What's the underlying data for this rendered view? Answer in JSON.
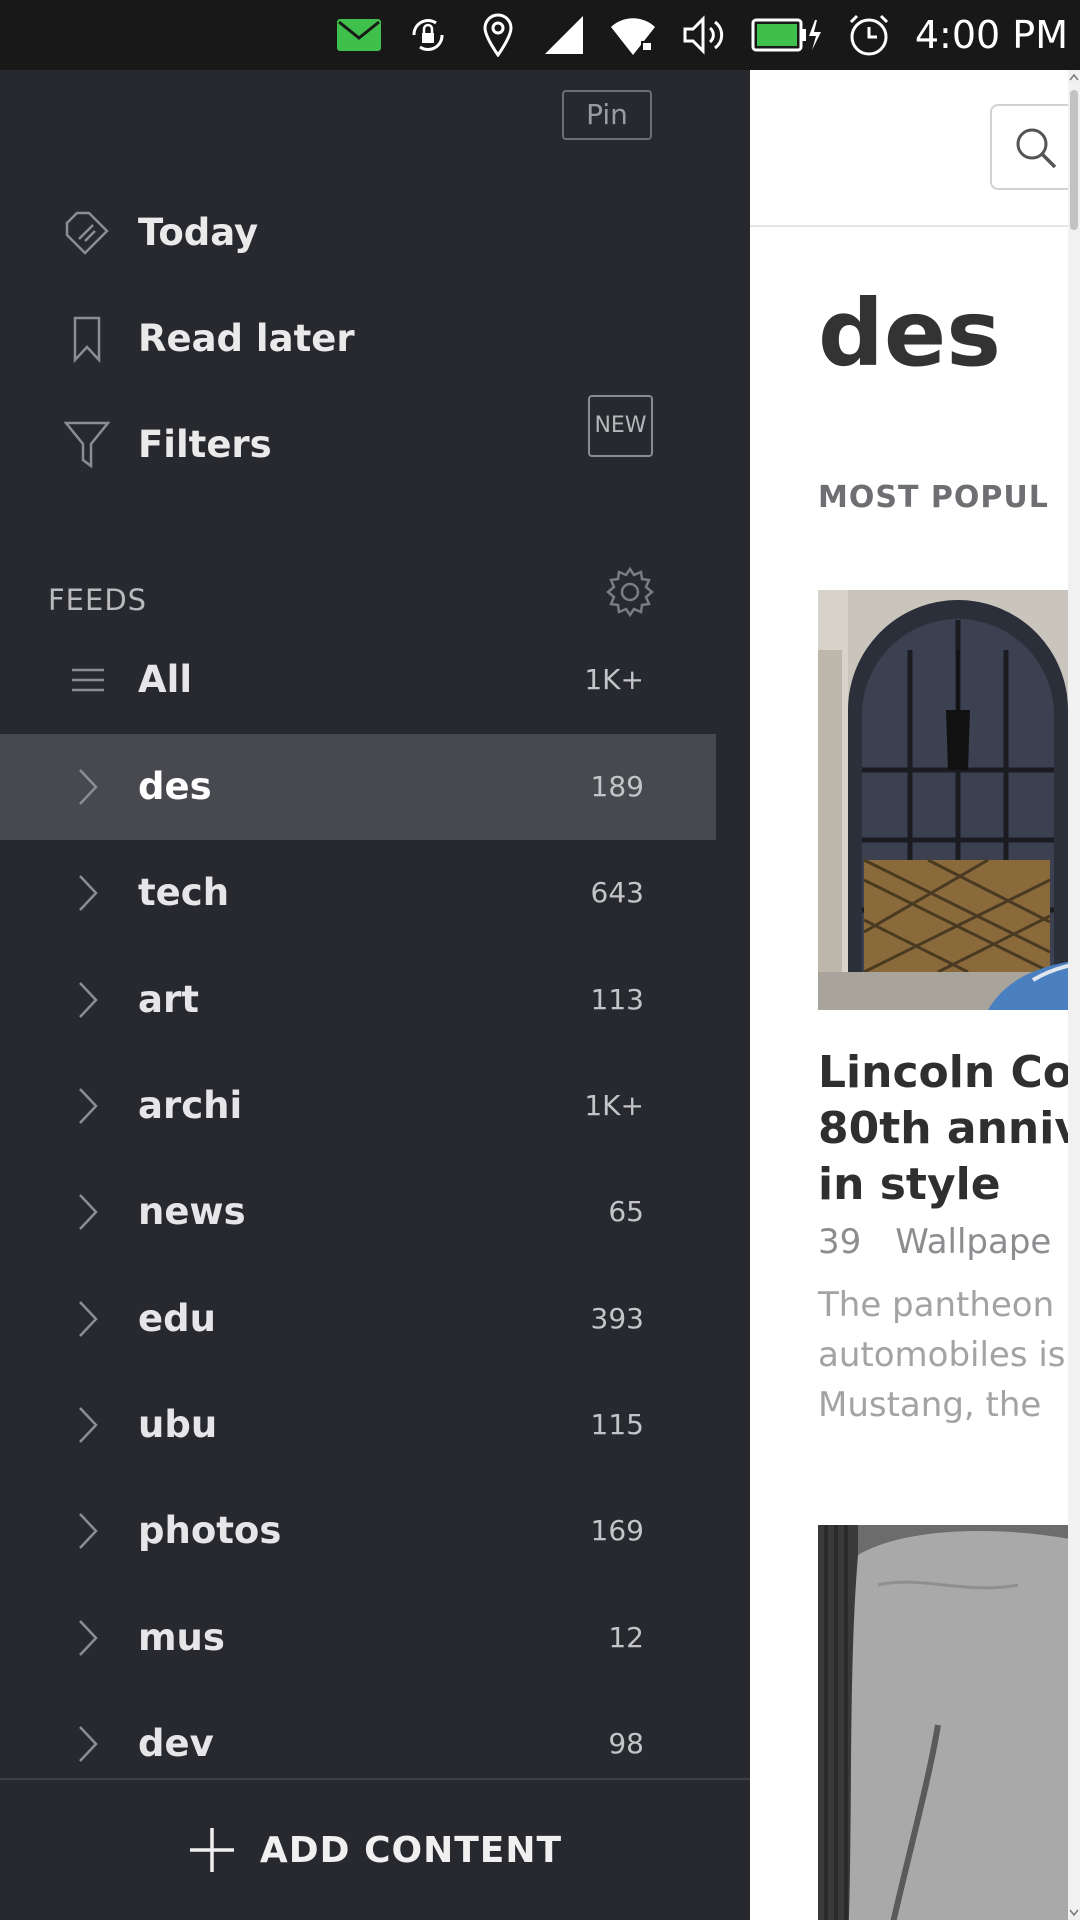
{
  "status_bar": {
    "time": "4:00 PM",
    "icons": [
      "mail-icon",
      "rotation-lock-icon",
      "location-icon",
      "signal-icon",
      "wifi-icon",
      "volume-icon",
      "battery-charging-icon",
      "alarm-icon"
    ],
    "mail_color": "#3fbf4b",
    "battery_color": "#3fbf4b"
  },
  "drawer": {
    "pin_label": "Pin",
    "nav": [
      {
        "label": "Today",
        "icon": "today-tag-icon"
      },
      {
        "label": "Read later",
        "icon": "bookmark-icon"
      },
      {
        "label": "Filters",
        "icon": "filter-icon",
        "badge": "NEW"
      }
    ],
    "feeds_header": "FEEDS",
    "feeds": [
      {
        "label": "All",
        "count": "1K+",
        "icon": "list-icon"
      },
      {
        "label": "des",
        "count": "189",
        "selected": true
      },
      {
        "label": "tech",
        "count": "643"
      },
      {
        "label": "art",
        "count": "113"
      },
      {
        "label": "archi",
        "count": "1K+"
      },
      {
        "label": "news",
        "count": "65"
      },
      {
        "label": "edu",
        "count": "393"
      },
      {
        "label": "ubu",
        "count": "115"
      },
      {
        "label": "photos",
        "count": "169"
      },
      {
        "label": "mus",
        "count": "12"
      },
      {
        "label": "dev",
        "count": "98"
      }
    ],
    "add_content_label": "ADD CONTENT",
    "background": "#28292e",
    "selected_background": "#48494e"
  },
  "content": {
    "title": "des",
    "section_label": "MOST POPUL",
    "article": {
      "title_lines": [
        "Lincoln Cor",
        "80th anniv",
        "in style"
      ],
      "meta_count": "39",
      "meta_source": "Wallpape",
      "snippet_lines": [
        "The pantheon",
        "automobiles is",
        "Mustang, the"
      ]
    }
  }
}
